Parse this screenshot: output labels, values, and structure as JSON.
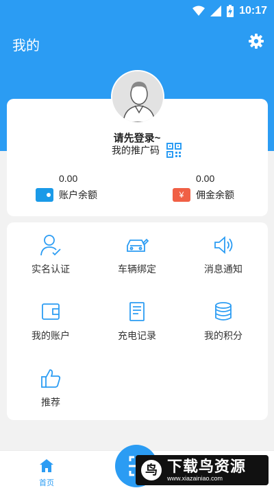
{
  "status_bar": {
    "time": "10:17"
  },
  "header": {
    "title": "我的"
  },
  "profile": {
    "login_prompt": "请先登录~",
    "promo_code_label": "我的推广码"
  },
  "balances": [
    {
      "amount": "0.00",
      "label": "账户余额",
      "icon": "wallet-icon"
    },
    {
      "amount": "0.00",
      "label": "佣金余额",
      "icon": "yen-icon",
      "icon_glyph": "¥"
    }
  ],
  "menu": {
    "items": [
      {
        "label": "实名认证",
        "icon": "id-verify-icon"
      },
      {
        "label": "车辆绑定",
        "icon": "car-bind-icon"
      },
      {
        "label": "消息通知",
        "icon": "speaker-icon"
      },
      {
        "label": "我的账户",
        "icon": "wallet-icon"
      },
      {
        "label": "充电记录",
        "icon": "record-icon"
      },
      {
        "label": "我的积分",
        "icon": "coins-icon"
      },
      {
        "label": "推荐",
        "icon": "thumbs-up-icon"
      }
    ]
  },
  "bottom_nav": {
    "home_label": "首页"
  },
  "watermark": {
    "logo_glyph": "鸟",
    "title": "下载鸟资源",
    "url": "www.xiazainiao.com"
  },
  "colors": {
    "primary": "#2b9cf3",
    "wallet": "#1a9ae8",
    "commission": "#f06045"
  }
}
